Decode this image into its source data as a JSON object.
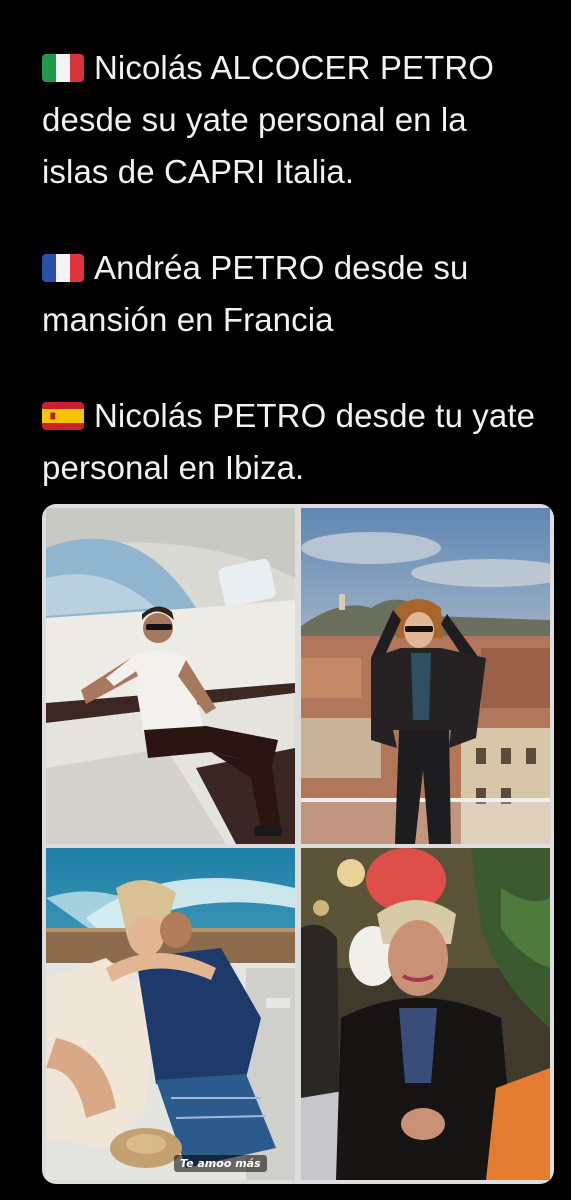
{
  "post": {
    "paragraphs": [
      {
        "flag": "flag-italy-icon",
        "text": "Nicolás ALCOCER PETRO desde su yate personal en la islas de CAPRI  Italia."
      },
      {
        "flag": "flag-france-icon",
        "text": "Andréa PETRO desde su mansión en Francia"
      },
      {
        "flag": "flag-spain-icon",
        "text": "Nicolás PETRO desde tu yate personal en Ibiza."
      }
    ]
  },
  "media": {
    "photos": [
      {
        "scene": "man seated in white shirt inside yacht cabin"
      },
      {
        "scene": "woman in leather jacket on rooftop over city"
      },
      {
        "scene": "couple embracing on boat deck"
      },
      {
        "scene": "woman in black coat at evening gathering"
      }
    ],
    "story_caption": "Te amoo más"
  },
  "colors": {
    "background": "#000000",
    "text": "#f2f2f2"
  }
}
